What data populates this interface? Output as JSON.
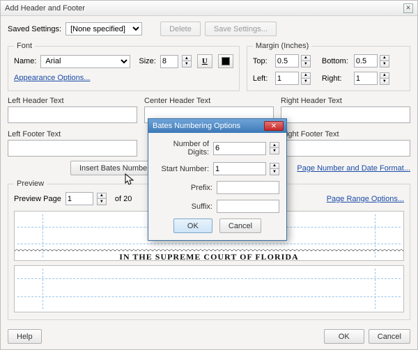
{
  "window": {
    "title": "Add Header and Footer"
  },
  "savedSettings": {
    "label": "Saved Settings:",
    "value": "[None specified]",
    "deleteLabel": "Delete",
    "saveLabel": "Save Settings..."
  },
  "font": {
    "legend": "Font",
    "nameLabel": "Name:",
    "nameValue": "Arial",
    "sizeLabel": "Size:",
    "sizeValue": "8",
    "underlineIcon": "underline-icon",
    "colorIcon": "text-color-icon",
    "appearanceLink": "Appearance Options..."
  },
  "margin": {
    "legend": "Margin (Inches)",
    "topLabel": "Top:",
    "topValue": "0.5",
    "bottomLabel": "Bottom:",
    "bottomValue": "0.5",
    "leftLabel": "Left:",
    "leftValue": "1",
    "rightLabel": "Right:",
    "rightValue": "1"
  },
  "headers": {
    "leftHeaderLabel": "Left Header Text",
    "centerHeaderLabel": "Center Header Text",
    "rightHeaderLabel": "Right Header Text",
    "leftFooterLabel": "Left Footer Text",
    "rightFooterLabel": "Right Footer Text",
    "leftHeaderValue": "",
    "centerHeaderValue": "",
    "rightHeaderValue": "",
    "leftFooterValue": "",
    "rightFooterValue": ""
  },
  "insertBates": "Insert Bates Number...",
  "links": {
    "pageNumberDate": "Page Number and Date Format...",
    "pageRange": "Page Range Options..."
  },
  "preview": {
    "legend": "Preview",
    "pageLabel": "Preview Page",
    "pageValue": "1",
    "ofLabel": "of 20",
    "courtText": "IN THE SUPREME COURT OF FLORIDA"
  },
  "bottom": {
    "help": "Help",
    "ok": "OK",
    "cancel": "Cancel"
  },
  "modal": {
    "title": "Bates Numbering Options",
    "digitsLabel": "Number of Digits:",
    "digitsValue": "6",
    "startLabel": "Start Number:",
    "startValue": "1",
    "prefixLabel": "Prefix:",
    "prefixValue": "",
    "suffixLabel": "Suffix:",
    "suffixValue": "",
    "ok": "OK",
    "cancel": "Cancel"
  }
}
